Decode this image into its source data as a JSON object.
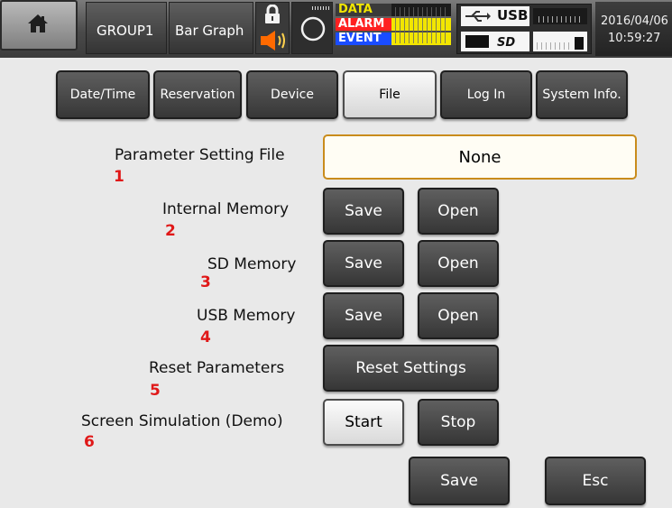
{
  "header": {
    "group": "GROUP1",
    "view": "Bar Graph",
    "status_labels": [
      "DATA",
      "ALARM",
      "EVENT"
    ],
    "usb_label": "USB",
    "date": "2016/04/06",
    "time": "10:59:27",
    "icons": [
      "home-icon",
      "lock-icon",
      "speaker-icon",
      "record-ring-icon",
      "usb-icon",
      "sd-card-icon"
    ]
  },
  "tabs": [
    {
      "label": "Date/Time",
      "active": false
    },
    {
      "label": "Reservation",
      "active": false
    },
    {
      "label": "Device",
      "active": false
    },
    {
      "label": "File",
      "active": true
    },
    {
      "label": "Log In",
      "active": false
    },
    {
      "label": "System Info.",
      "active": false
    }
  ],
  "rows": {
    "param_file": {
      "label": "Parameter Setting File",
      "num": "1",
      "value": "None"
    },
    "internal": {
      "label": "Internal Memory",
      "num": "2",
      "save": "Save",
      "open": "Open"
    },
    "sd": {
      "label": "SD Memory",
      "num": "3",
      "save": "Save",
      "open": "Open"
    },
    "usb": {
      "label": "USB Memory",
      "num": "4",
      "save": "Save",
      "open": "Open"
    },
    "reset": {
      "label": "Reset Parameters",
      "num": "5",
      "button": "Reset Settings"
    },
    "sim": {
      "label": "Screen Simulation (Demo)",
      "num": "6",
      "start": "Start",
      "stop": "Stop"
    }
  },
  "footer": {
    "save": "Save",
    "esc": "Esc"
  },
  "colors": {
    "alarm": "#ff2020",
    "data": "#f2e600",
    "event": "#1a4cff",
    "accent_border": "#c98c1c",
    "row_number": "#e01818"
  }
}
